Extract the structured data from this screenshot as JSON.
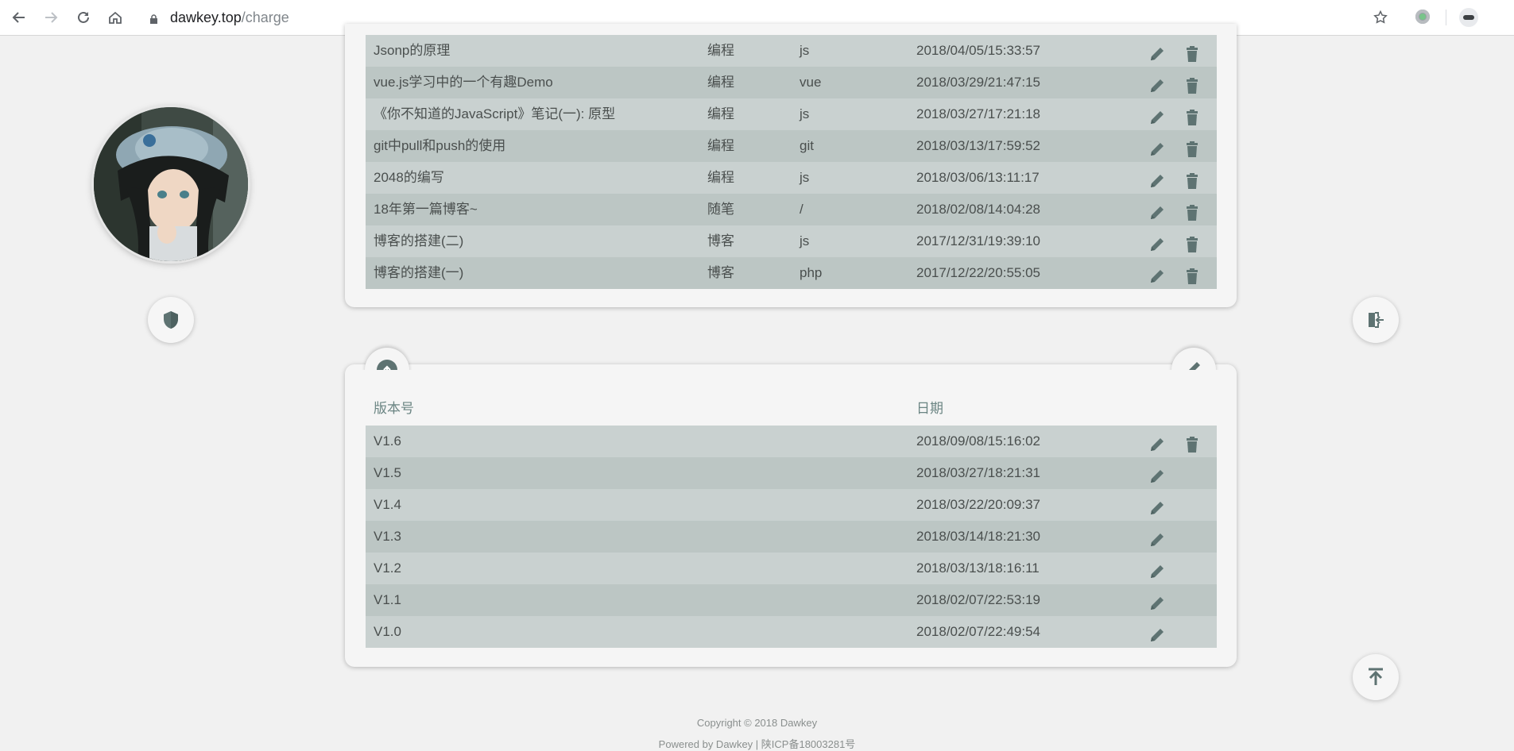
{
  "browser": {
    "url_host": "dawkey.top",
    "url_path": "/charge",
    "back_icon": "arrow-left-icon",
    "forward_icon": "arrow-right-icon",
    "reload_icon": "reload-icon",
    "home_icon": "home-icon",
    "bookmark_icon": "star-icon"
  },
  "colors": {
    "accent": "#5e7372",
    "row_odd": "#c9d1d0",
    "row_even": "#bcc6c4",
    "header_text": "#6b8583"
  },
  "posts": [
    {
      "title": "Jsonp的原理",
      "category": "编程",
      "tag": "js",
      "date": "2018/04/05/15:33:57"
    },
    {
      "title": "vue.js学习中的一个有趣Demo",
      "category": "编程",
      "tag": "vue",
      "date": "2018/03/29/21:47:15"
    },
    {
      "title": "《你不知道的JavaScript》笔记(一): 原型",
      "category": "编程",
      "tag": "js",
      "date": "2018/03/27/17:21:18"
    },
    {
      "title": "git中pull和push的使用",
      "category": "编程",
      "tag": "git",
      "date": "2018/03/13/17:59:52"
    },
    {
      "title": "2048的编写",
      "category": "编程",
      "tag": "js",
      "date": "2018/03/06/13:11:17"
    },
    {
      "title": "18年第一篇博客~",
      "category": "随笔",
      "tag": "/",
      "date": "2018/02/08/14:04:28"
    },
    {
      "title": "博客的搭建(二)",
      "category": "博客",
      "tag": "js",
      "date": "2017/12/31/19:39:10"
    },
    {
      "title": "博客的搭建(一)",
      "category": "博客",
      "tag": "php",
      "date": "2017/12/22/20:55:05"
    }
  ],
  "versions": {
    "header": {
      "version": "版本号",
      "date": "日期"
    },
    "rows": [
      {
        "version": "V1.6",
        "date": "2018/09/08/15:16:02",
        "deletable": true
      },
      {
        "version": "V1.5",
        "date": "2018/03/27/18:21:31",
        "deletable": false
      },
      {
        "version": "V1.4",
        "date": "2018/03/22/20:09:37",
        "deletable": false
      },
      {
        "version": "V1.3",
        "date": "2018/03/14/18:21:30",
        "deletable": false
      },
      {
        "version": "V1.2",
        "date": "2018/03/13/18:16:11",
        "deletable": false
      },
      {
        "version": "V1.1",
        "date": "2018/02/07/22:53:19",
        "deletable": false
      },
      {
        "version": "V1.0",
        "date": "2018/02/07/22:49:54",
        "deletable": false
      }
    ]
  },
  "footer": {
    "copyright": "Copyright © 2018 Dawkey",
    "powered": "Powered by Dawkey",
    "icp": "陕ICP备18003281号"
  }
}
